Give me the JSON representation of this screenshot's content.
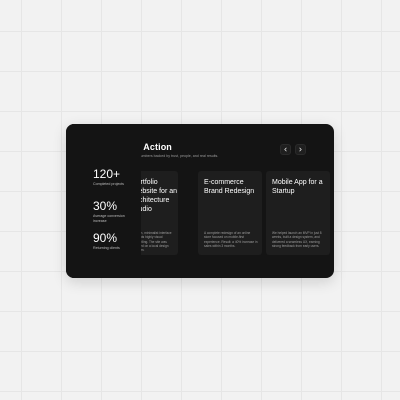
{
  "section": {
    "title": "Success in Action",
    "subtitle": "Projects we're proud of, and numbers backed by trust, people, and real results."
  },
  "navigation": {
    "prev_icon": "chevron-left-icon",
    "next_icon": "chevron-right-icon"
  },
  "stats": [
    {
      "value": "120+",
      "label": "Completed projects"
    },
    {
      "value": "30%",
      "label": "Average conversion increase"
    },
    {
      "value": "90%",
      "label": "Returning clients"
    }
  ],
  "projects": [
    {
      "title": "Portfolio Website for an Architecture Studio",
      "description": "A clean, minimalist interface that puts highly visual storytelling. The site was featured on a local design platform."
    },
    {
      "title": "E-commerce Brand Redesign",
      "description": "A complete redesign of an online store focused on mobile-first experience. Result: a 40% increase in sales within 3 months."
    },
    {
      "title": "Mobile App for a Startup",
      "description": "We helped launch an MVP in just 8 weeks, built a design system, and delivered a seamless UX, earning strong feedback from early users."
    }
  ],
  "colors": {
    "card_background": "#141414",
    "project_card_background": "#1e1e1e",
    "page_background": "#f2f2f2"
  }
}
